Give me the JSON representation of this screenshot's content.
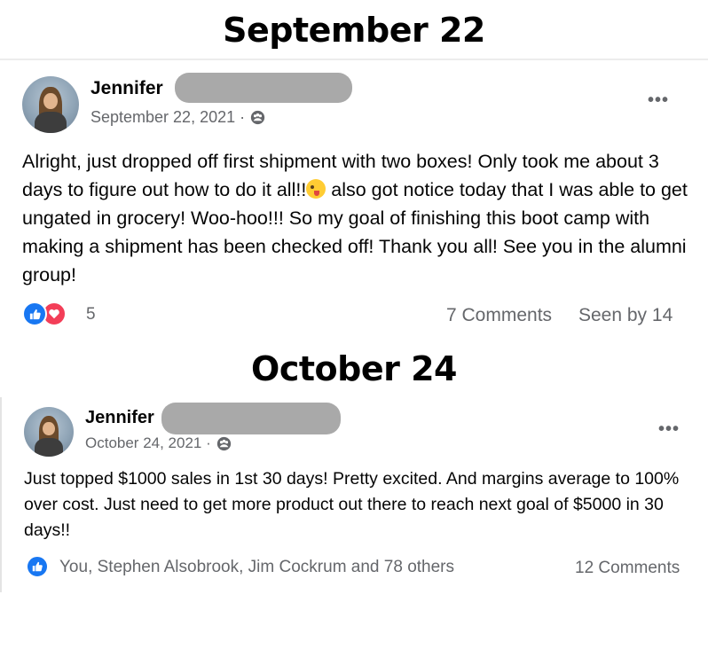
{
  "sections": [
    {
      "heading": "September 22",
      "author": "Jennifer",
      "date": "September 22, 2021 ·",
      "text": "Alright, just dropped off first shipment with two boxes! Only took me about 3 days to figure out how to do it all!!",
      "text_after_emoji": " also got notice today that I was able to get ungated in grocery! Woo-hoo!!! So my goal of finishing this boot camp with making a shipment has been checked off! Thank you all! See you in the alumni group!",
      "reaction_count": "5",
      "comments": "7 Comments",
      "seen_by": "Seen by 14",
      "more": "•••"
    },
    {
      "heading": "October 24",
      "author": "Jennifer",
      "date": "October 24, 2021 ·",
      "text": "Just topped $1000 sales in 1st 30 days! Pretty excited. And margins average to 100% over cost. Just need to get more product out there to reach next goal of $5000 in 30 days!!",
      "reactors": "You, Stephen Alsobrook, Jim Cockrum and 78 others",
      "comments": "12 Comments",
      "more": "•••"
    }
  ],
  "colors": {
    "like": "#1877f2",
    "love": "#f33e58",
    "secondary_text": "#65676b",
    "redaction": "#a9a9a9"
  }
}
